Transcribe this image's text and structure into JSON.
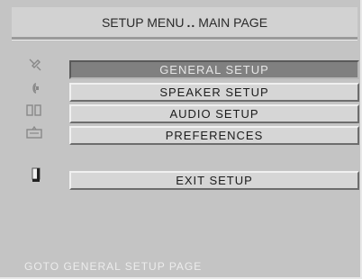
{
  "header": {
    "title_left": "SETUP MENU",
    "separator": "..",
    "title_right": "MAIN PAGE"
  },
  "menu": {
    "items": [
      {
        "label": "GENERAL SETUP",
        "icon": "tools-icon",
        "selected": true
      },
      {
        "label": "SPEAKER SETUP",
        "icon": "speaker-icon",
        "selected": false
      },
      {
        "label": "AUDIO SETUP",
        "icon": "audio-icon",
        "selected": false
      },
      {
        "label": "PREFERENCES",
        "icon": "preferences-icon",
        "selected": false
      }
    ],
    "exit": {
      "label": "EXIT SETUP",
      "icon": "exit-door-icon"
    }
  },
  "status": {
    "text": "GOTO GENERAL SETUP PAGE"
  },
  "colors": {
    "background": "#c4c4c4",
    "selected_row": "#808080",
    "row": "#d6d6d6",
    "status_text": "#ececec"
  }
}
